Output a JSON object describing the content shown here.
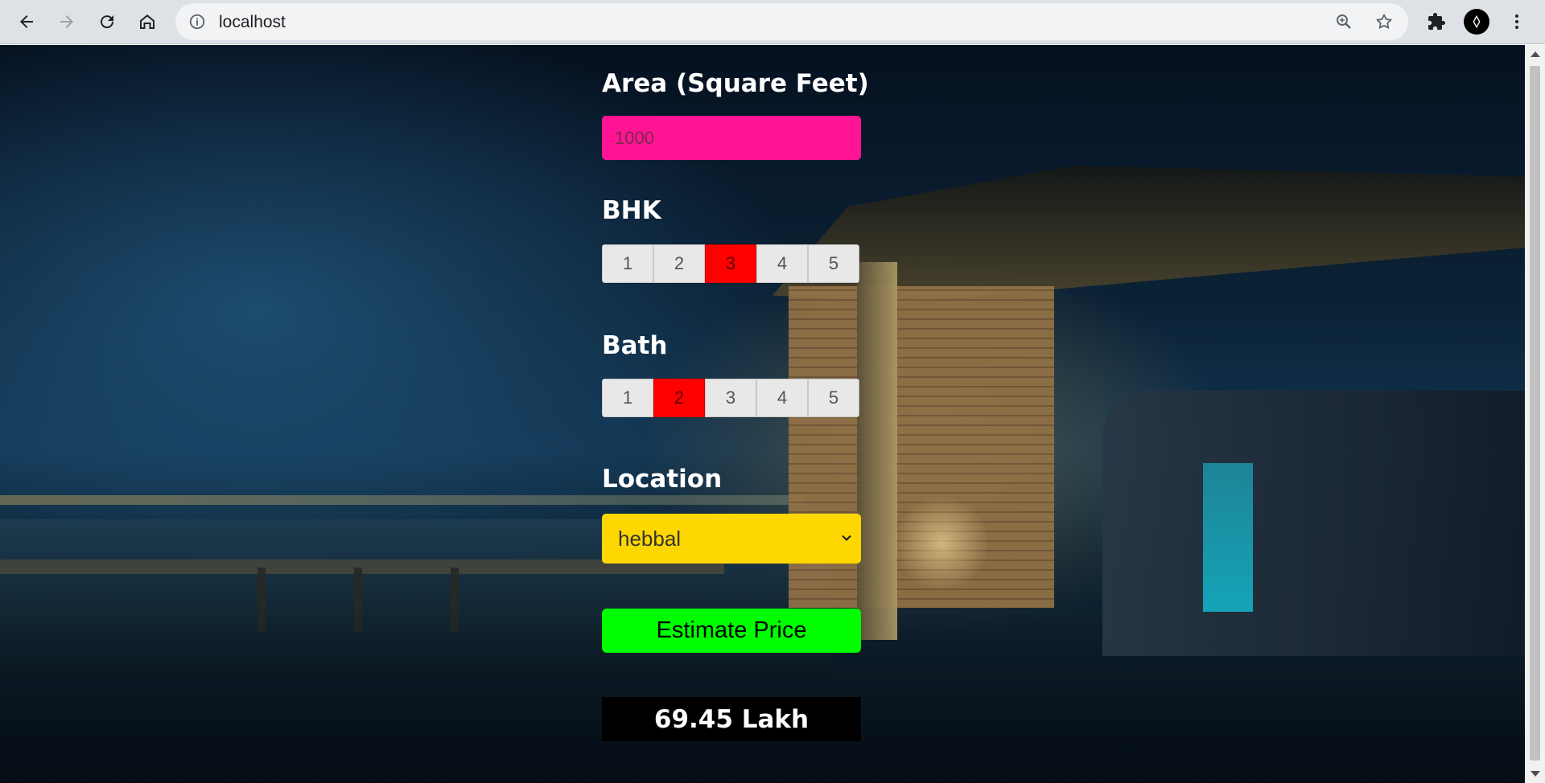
{
  "browser": {
    "url": "localhost",
    "icons": {
      "back": "arrow-left-icon",
      "forward": "arrow-right-icon",
      "reload": "reload-icon",
      "home": "home-icon",
      "site_info": "info-icon",
      "zoom": "zoom-icon",
      "bookmark": "star-icon",
      "extensions": "puzzle-icon",
      "profile": "avatar",
      "menu": "kebab-menu-icon"
    }
  },
  "form": {
    "area": {
      "title": "Area (Square Feet)",
      "value": "1000"
    },
    "bhk": {
      "title": "BHK",
      "options": [
        "1",
        "2",
        "3",
        "4",
        "5"
      ],
      "selected": "3"
    },
    "bath": {
      "title": "Bath",
      "options": [
        "1",
        "2",
        "3",
        "4",
        "5"
      ],
      "selected": "2"
    },
    "location": {
      "title": "Location",
      "selected": "hebbal"
    },
    "estimate_button": "Estimate Price",
    "result": "69.45 Lakh"
  },
  "colors": {
    "area_input": "#ff1493",
    "segment_active": "#ff0000",
    "segment_inactive": "#e8e8e8",
    "location_select": "#ffd700",
    "estimate_button": "#00ff00",
    "result_box": "#000000",
    "titles": "#ffffff"
  }
}
